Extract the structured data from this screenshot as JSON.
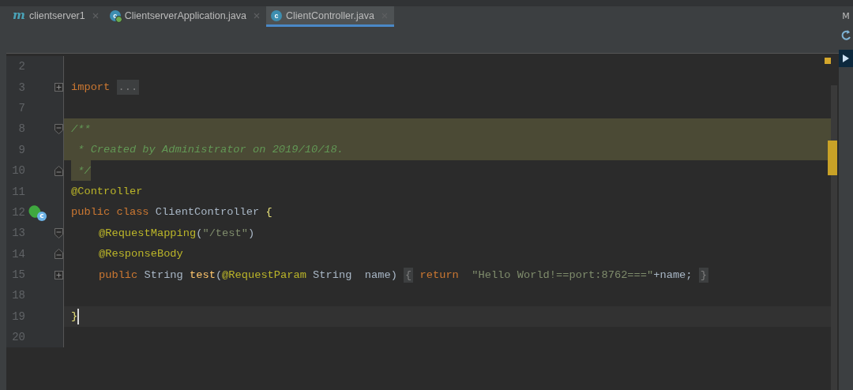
{
  "tabs": [
    {
      "label": "clientserver1",
      "selected": false,
      "icon": {
        "kind": "module",
        "letter": "m"
      }
    },
    {
      "label": "ClientserverApplication.java",
      "selected": false,
      "icon": {
        "kind": "spring-class",
        "letter": "c"
      }
    },
    {
      "label": "ClientController.java",
      "selected": true,
      "icon": {
        "kind": "class",
        "letter": "c"
      }
    }
  ],
  "right_toolbar": {
    "label": "M"
  },
  "lines": [
    {
      "number": "2"
    },
    {
      "number": "3",
      "fold": {
        "kind": "collapsed"
      },
      "tokens": [
        {
          "text": "import ",
          "kind": "keyword"
        },
        {
          "text": "...",
          "kind": "folded"
        }
      ]
    },
    {
      "number": "7"
    },
    {
      "number": "8",
      "fold": {
        "kind": "start"
      },
      "highlight": {
        "kind": "line"
      },
      "tokens": [
        {
          "text": "/**",
          "kind": "comment"
        }
      ]
    },
    {
      "number": "9",
      "highlight": {
        "kind": "line"
      },
      "tokens": [
        {
          "text": " * Created by Administrator on 2019/10/18.",
          "kind": "comment"
        }
      ]
    },
    {
      "number": "10",
      "fold": {
        "kind": "end"
      },
      "highlight": {
        "kind": "text"
      },
      "tokens": [
        {
          "text": " */",
          "kind": "comment"
        }
      ]
    },
    {
      "number": "11",
      "tokens": [
        {
          "text": "@Controller",
          "kind": "annotation"
        }
      ]
    },
    {
      "number": "12",
      "gutter_icon": {
        "kind": "spring-bean",
        "letter": "c"
      },
      "tokens": [
        {
          "text": "public class",
          "kind": "keyword"
        },
        {
          "text": " ClientController "
        },
        {
          "text": "{",
          "kind": "brace"
        }
      ]
    },
    {
      "number": "13",
      "indented": true,
      "fold": {
        "kind": "start"
      },
      "tokens": [
        {
          "text": "@RequestMapping",
          "kind": "annotation"
        },
        {
          "text": "("
        },
        {
          "text": "\"/test\"",
          "kind": "string"
        },
        {
          "text": ")"
        }
      ]
    },
    {
      "number": "14",
      "indented": true,
      "fold": {
        "kind": "end"
      },
      "tokens": [
        {
          "text": "@ResponseBody",
          "kind": "annotation"
        }
      ]
    },
    {
      "number": "15",
      "indented": true,
      "fold": {
        "kind": "collapsed"
      },
      "tokens": [
        {
          "text": "public",
          "kind": "keyword"
        },
        {
          "text": " String "
        },
        {
          "text": "test",
          "kind": "method"
        },
        {
          "text": "("
        },
        {
          "text": "@RequestParam",
          "kind": "annotation"
        },
        {
          "text": " String  name) "
        },
        {
          "text": "{",
          "kind": "folded"
        },
        {
          "text": " return",
          "kind": "keyword"
        },
        {
          "text": "  \"Hello World!==port:8762===\"",
          "kind": "string"
        },
        {
          "text": "+name; "
        },
        {
          "text": "}",
          "kind": "folded"
        }
      ]
    },
    {
      "number": "18"
    },
    {
      "number": "19",
      "current": true,
      "tokens": [
        {
          "text": "}",
          "kind": "brace"
        }
      ]
    },
    {
      "number": "20"
    }
  ]
}
